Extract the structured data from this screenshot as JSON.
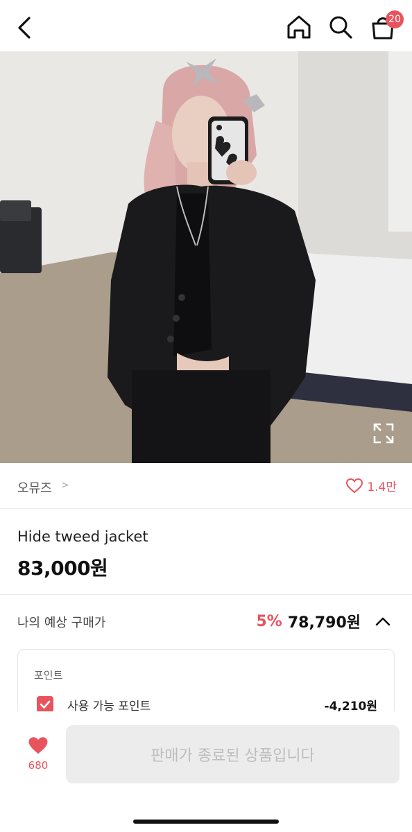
{
  "header": {
    "cart_count": "20",
    "icons": [
      "back-icon",
      "home-icon",
      "search-icon",
      "cart-icon"
    ]
  },
  "product": {
    "image_icon": "expand-icon",
    "brand": "오뮤즈",
    "brand_chevron": ">",
    "likes": "1.4만",
    "title": "Hide tweed jacket",
    "price": "83,000원"
  },
  "expected": {
    "label": "나의 예상 구매가",
    "discount": "5%",
    "price": "78,790원"
  },
  "points": {
    "title": "포인트",
    "item_label": "사용 가능 포인트",
    "item_value": "-4,210원",
    "checked": true
  },
  "bottom": {
    "fav_count": "680",
    "button_label": "판매가 종료된 상품입니다"
  },
  "colors": {
    "accent": "#e8545e",
    "disabled_bg": "#ececec",
    "disabled_text": "#bdbdbd"
  }
}
